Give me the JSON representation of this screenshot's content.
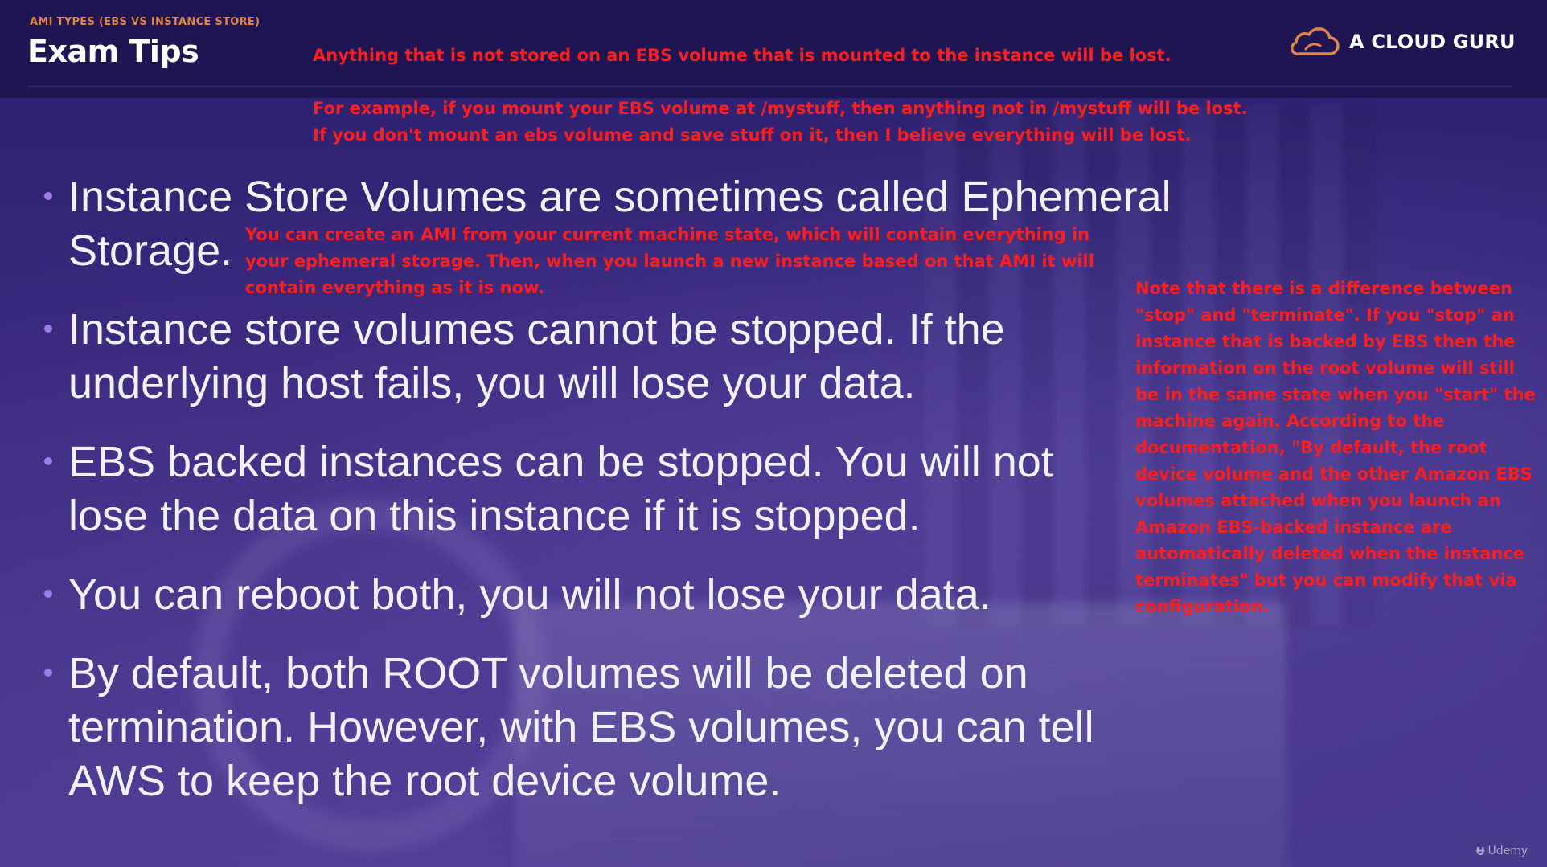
{
  "header": {
    "kicker": "AMI TYPES (EBS VS INSTANCE STORE)",
    "title": "Exam Tips",
    "logo_text": "A CLOUD GURU"
  },
  "annotations": {
    "note1": "Anything that is not stored on an EBS volume that is mounted to the instance will be lost.",
    "note2": "For example, if you mount your EBS volume at /mystuff, then anything not in /mystuff will be lost. If you don't mount an ebs volume and save stuff on it, then I believe everything will be lost.",
    "note3": "You can create an AMI from your current machine state, which will contain everything in your ephemeral storage. Then, when you launch a new instance based on that AMI it will contain everything as it is now.",
    "note4": "Note that there is a difference between \"stop\" and \"terminate\". If you \"stop\" an instance that is backed by EBS then the information on the root volume will still be in the same state when you \"start\" the machine again. According to the documentation, \"By default, the root device volume and the other Amazon EBS volumes attached when you launch an Amazon EBS-backed instance are automatically deleted when the instance terminates\" but you can modify that via configuration."
  },
  "bullets": [
    "Instance Store Volumes are sometimes called Ephemeral Storage.",
    "Instance store volumes cannot be stopped. If the underlying host fails, you will lose your data.",
    "EBS backed instances can be stopped. You will not lose the data on this instance if it is stopped.",
    "You can reboot both, you will not lose your data.",
    "By default, both ROOT volumes will be deleted on termination. However, with EBS volumes, you can tell AWS to keep the root device volume."
  ],
  "watermark": {
    "label": "Udemy"
  },
  "colors": {
    "header_bg": "#1f1552",
    "kicker": "#e0844a",
    "annotation_red": "#ff1e1e",
    "bullet_dot": "#9b7ee8",
    "logo_cloud": "#e0844a"
  },
  "icons": {
    "logo": "cloud-icon",
    "bullet": "bullet-dot",
    "watermark": "udemy-logo-icon"
  }
}
